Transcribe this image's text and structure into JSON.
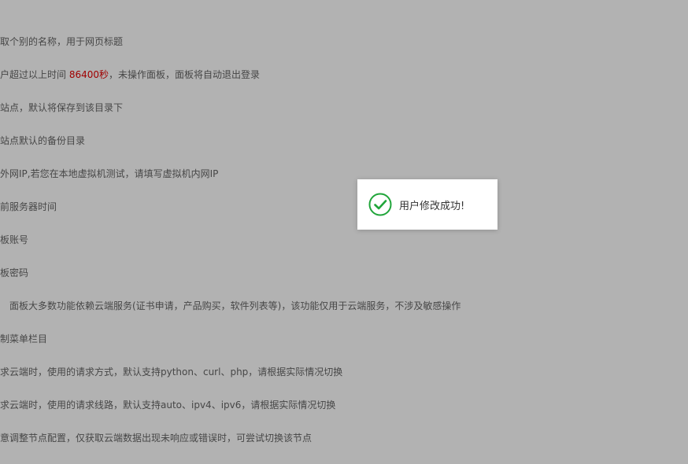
{
  "settings": {
    "rows": [
      {
        "text": "取个别的名称，用于网页标题"
      },
      {
        "before": "户超过以上时间 ",
        "highlight": "86400秒",
        "after": "，未操作面板，面板将自动退出登录"
      },
      {
        "text": "站点，默认将保存到该目录下"
      },
      {
        "text": "站点默认的备份目录"
      },
      {
        "text": "外网IP,若您在本地虚拟机测试，请填写虚拟机内网IP"
      },
      {
        "text": "前服务器时间"
      },
      {
        "text": "板账号"
      },
      {
        "text": "板密码"
      },
      {
        "text": "面板大多数功能依赖云端服务(证书申请，产品购买，软件列表等)，该功能仅用于云端服务，不涉及敏感操作"
      },
      {
        "text": "制菜单栏目"
      },
      {
        "text": "求云端时，使用的请求方式，默认支持python、curl、php，请根据实际情况切换"
      },
      {
        "text": "求云端时，使用的请求线路，默认支持auto、ipv4、ipv6，请根据实际情况切换"
      },
      {
        "text": "意调整节点配置，仅获取云端数据出现未响应或错误时，可尝试切换该节点"
      }
    ]
  },
  "toast": {
    "icon": "success-check-icon",
    "message": "用户修改成功!"
  },
  "colors": {
    "accent_success": "#20a53a",
    "highlight": "#e60000",
    "overlay": "rgba(0,0,0,0.3)"
  }
}
